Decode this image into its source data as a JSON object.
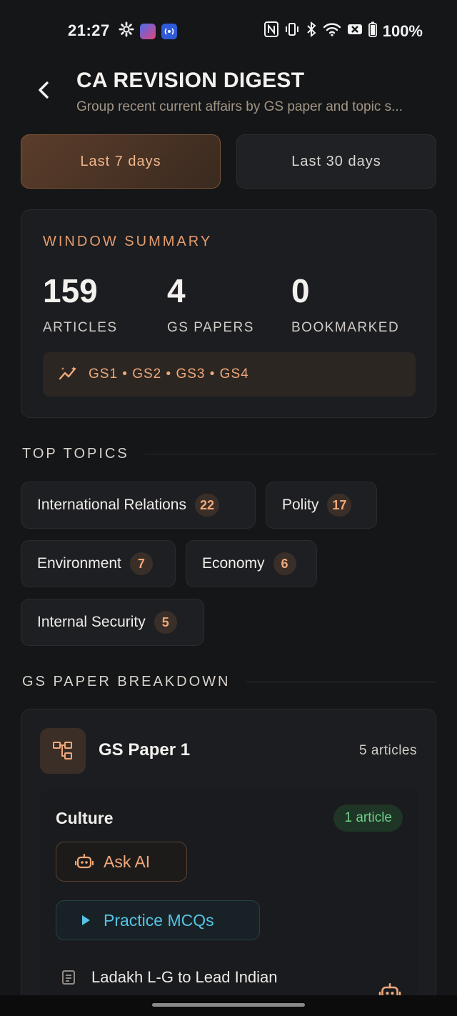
{
  "status_bar": {
    "time": "21:27",
    "battery": "100%",
    "left_icons": [
      "gear-icon",
      "app-icon",
      "broadcast-icon"
    ],
    "right_icons": [
      "nfc-icon",
      "vibrate-icon",
      "bluetooth-icon",
      "wifi-icon",
      "signal-off-icon",
      "battery-icon"
    ]
  },
  "header": {
    "title": "CA REVISION DIGEST",
    "subtitle": "Group recent current affairs by GS paper and topic s..."
  },
  "tabs": [
    {
      "label": "Last 7 days",
      "active": true
    },
    {
      "label": "Last 30 days",
      "active": false
    }
  ],
  "summary": {
    "label": "WINDOW SUMMARY",
    "stats": [
      {
        "value": "159",
        "label": "ARTICLES"
      },
      {
        "value": "4",
        "label": "GS PAPERS"
      },
      {
        "value": "0",
        "label": "BOOKMARKED"
      }
    ],
    "papers": "GS1 • GS2 • GS3 • GS4"
  },
  "top_topics": {
    "label": "TOP TOPICS",
    "items": [
      {
        "name": "International Relations",
        "count": "22"
      },
      {
        "name": "Polity",
        "count": "17"
      },
      {
        "name": "Environment",
        "count": "7"
      },
      {
        "name": "Economy",
        "count": "6"
      },
      {
        "name": "Internal Security",
        "count": "5"
      }
    ]
  },
  "breakdown": {
    "label": "GS PAPER BREAKDOWN",
    "paper": {
      "title": "GS Paper 1",
      "count": "5 articles",
      "topic": {
        "name": "Culture",
        "badge": "1 article",
        "ask_ai": "Ask AI",
        "practice": "Practice MCQs",
        "article_title": "Ladakh L-G to Lead Indian"
      }
    }
  },
  "colors": {
    "background": "#151618",
    "accent_orange": "#f0a87a",
    "accent_cyan": "#56c3e6",
    "accent_green": "#6fd08a"
  }
}
